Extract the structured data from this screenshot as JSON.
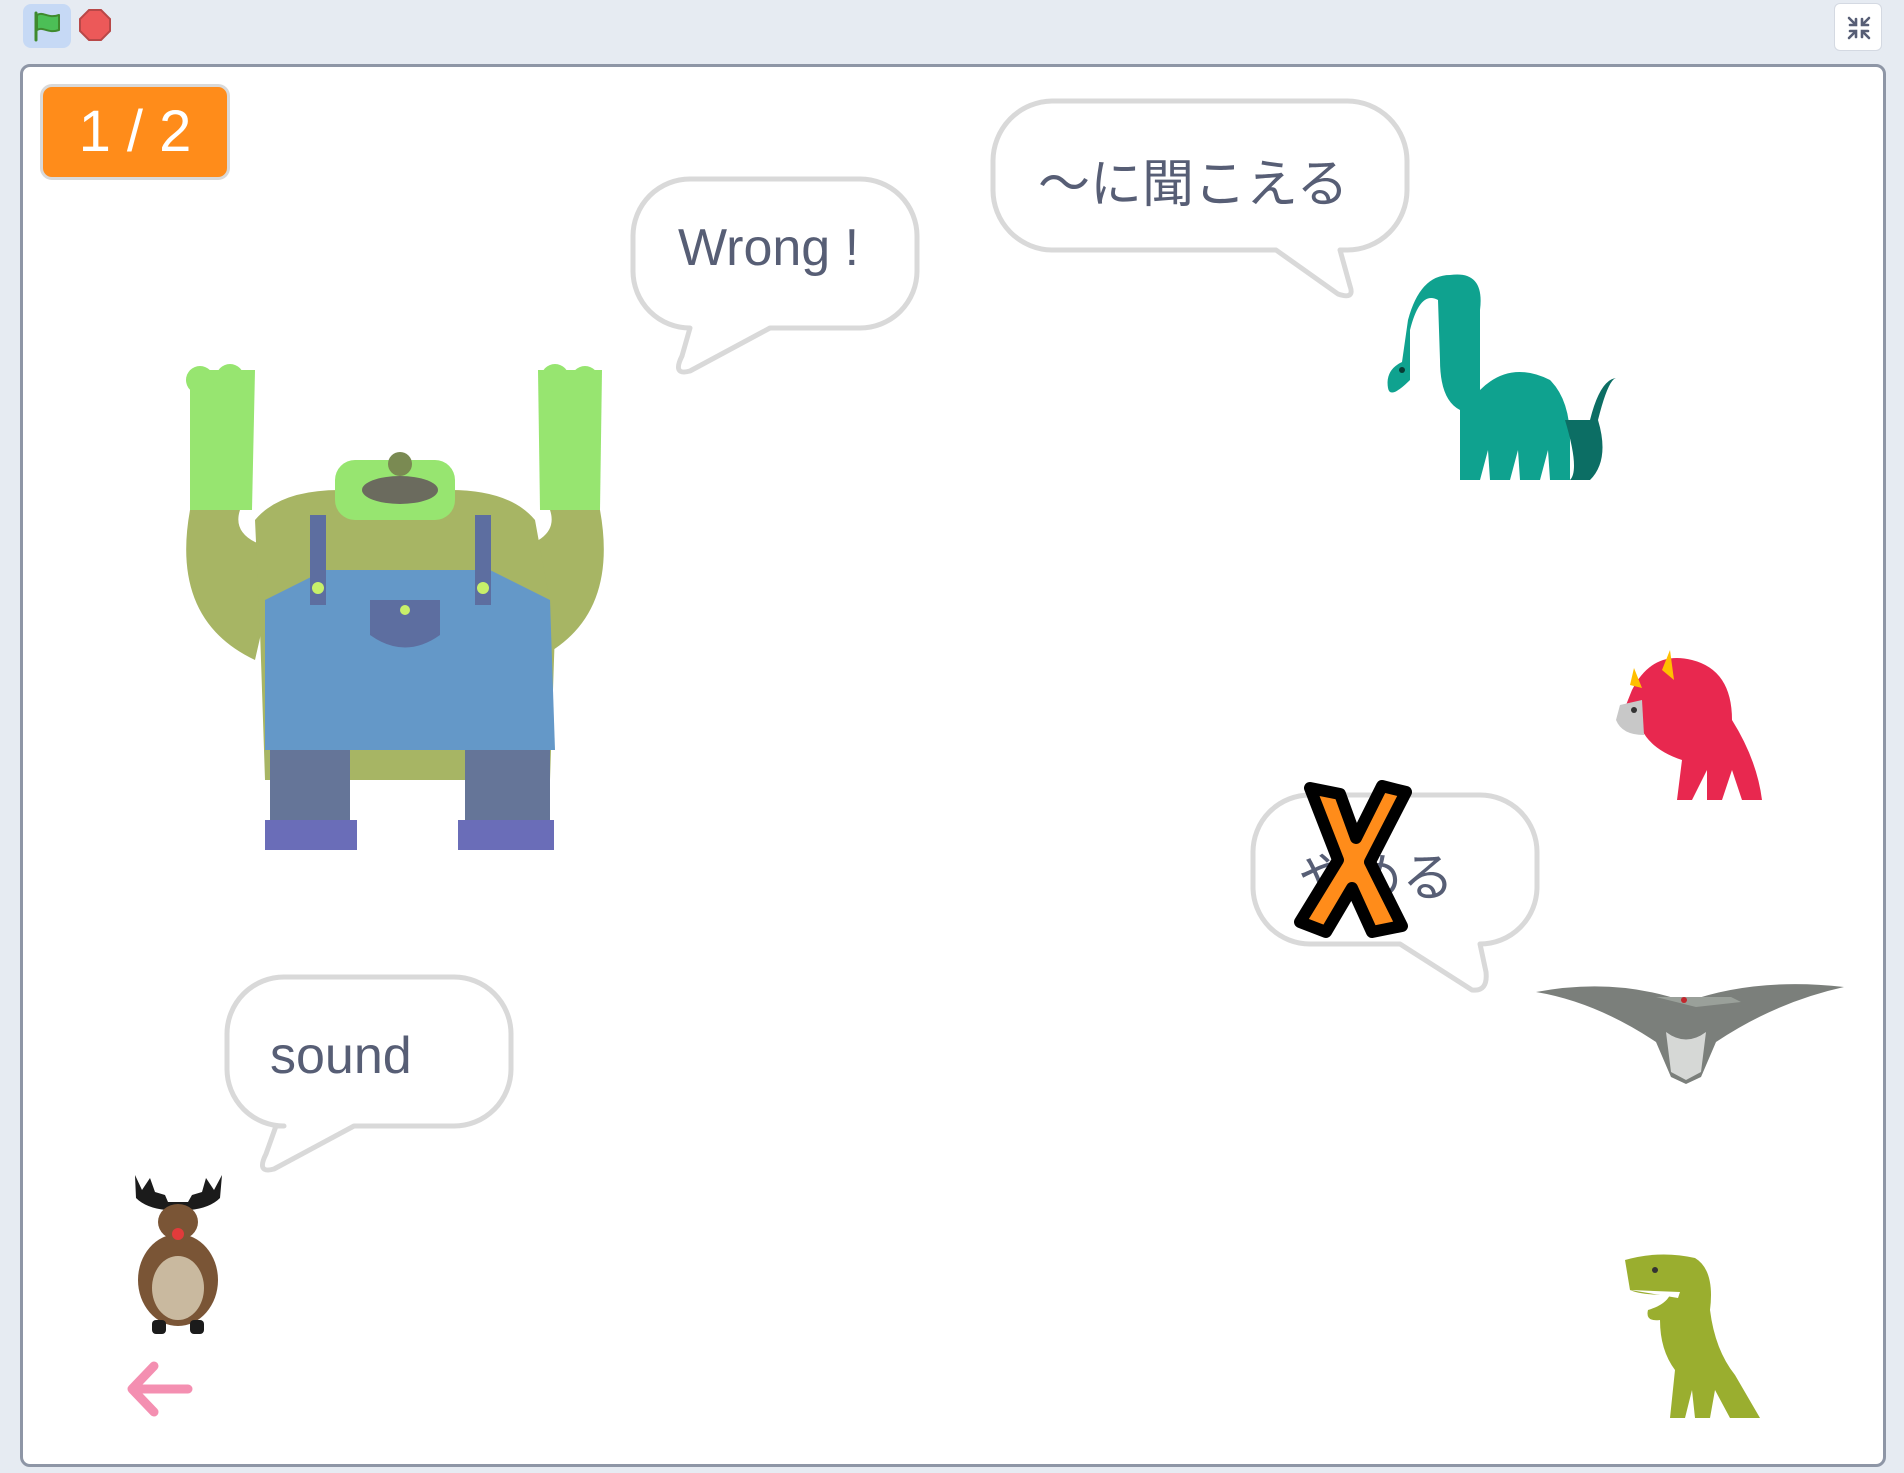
{
  "toolbar": {
    "green_flag_icon": "green-flag-icon",
    "stop_icon": "stop-sign-icon",
    "fullscreen_icon": "exit-fullscreen-icon"
  },
  "stage": {
    "counter": "1 / 2",
    "bubbles": {
      "monster": "Wrong !",
      "dinosaur": "～に聞こえる",
      "moose": "sound",
      "answer": "やめる"
    },
    "icons": {
      "wrong_mark": "x-mark-icon",
      "back": "back-arrow-icon"
    }
  },
  "colors": {
    "counter_bg": "#ff8c1a",
    "bubble_text": "#575e75",
    "back_arrow": "#f48fb1",
    "wrong_mark": "#ff8c1a"
  }
}
